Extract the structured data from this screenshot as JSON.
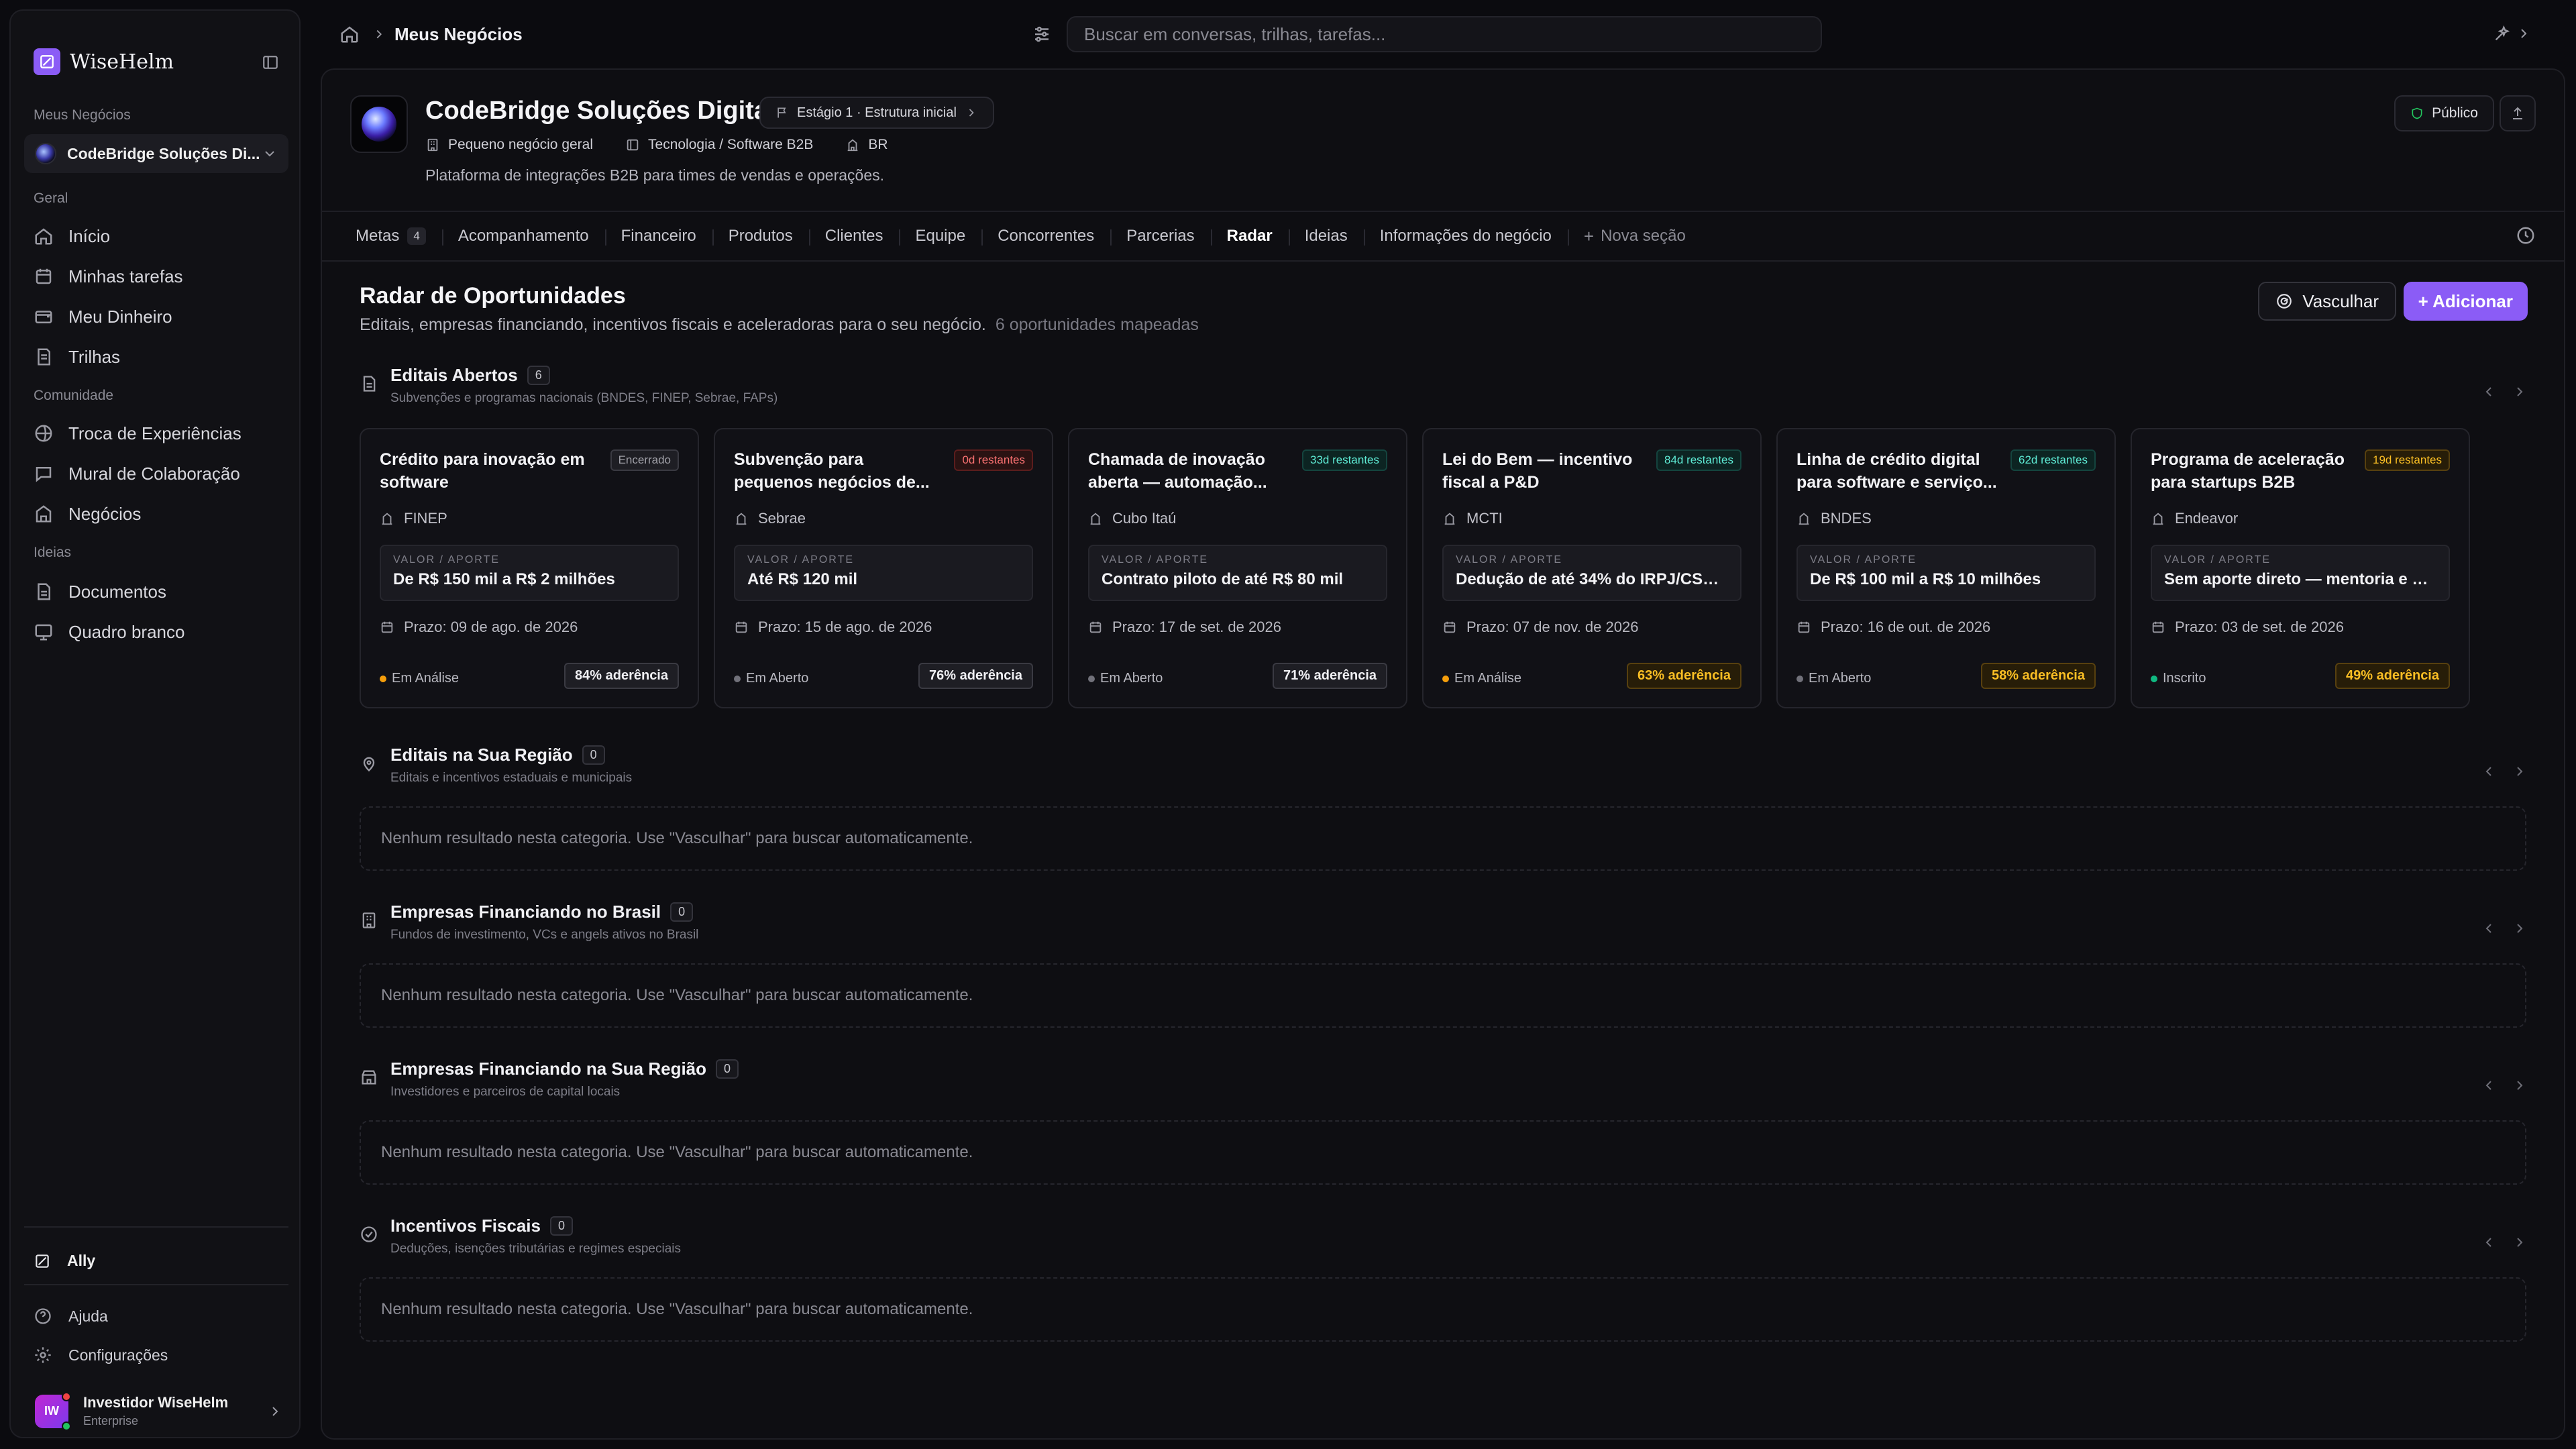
{
  "brand": {
    "name": "WiseHelm"
  },
  "sidebar": {
    "my_business_label": "Meus Negócios",
    "selected_business": "CodeBridge Soluções Di...",
    "general_label": "Geral",
    "general_items": [
      {
        "label": "Início",
        "icon": "home-icon"
      },
      {
        "label": "Minhas tarefas",
        "icon": "tasks-icon"
      },
      {
        "label": "Meu Dinheiro",
        "icon": "money-icon"
      },
      {
        "label": "Trilhas",
        "icon": "tracks-icon"
      }
    ],
    "community_label": "Comunidade",
    "community_items": [
      {
        "label": "Troca de Experiências",
        "icon": "chat-icon"
      },
      {
        "label": "Mural de Colaboração",
        "icon": "board-icon"
      },
      {
        "label": "Negócios",
        "icon": "business-icon"
      }
    ],
    "ideas_label": "Ideias",
    "ideas_items": [
      {
        "label": "Documentos",
        "icon": "document-icon"
      },
      {
        "label": "Quadro branco",
        "icon": "whiteboard-icon"
      }
    ],
    "ally": "Ally",
    "help": "Ajuda",
    "settings": "Configurações",
    "user": {
      "initials": "IW",
      "name": "Investidor WiseHelm",
      "plan": "Enterprise"
    }
  },
  "topbar": {
    "breadcrumb": "Meus Negócios",
    "search_placeholder": "Buscar em conversas, trilhas, tarefas..."
  },
  "business": {
    "name": "CodeBridge Soluções Digitais",
    "stage": "Estágio 1 · Estrutura inicial",
    "size": "Pequeno negócio geral",
    "sector": "Tecnologia / Software B2B",
    "country": "BR",
    "description": "Plataforma de integrações B2B para times de vendas e operações.",
    "visibility": "Público"
  },
  "tabs": [
    {
      "label": "Metas",
      "count": "4"
    },
    {
      "label": "Acompanhamento"
    },
    {
      "label": "Financeiro"
    },
    {
      "label": "Produtos"
    },
    {
      "label": "Clientes"
    },
    {
      "label": "Equipe"
    },
    {
      "label": "Concorrentes"
    },
    {
      "label": "Parcerias"
    },
    {
      "label": "Radar",
      "active": true
    },
    {
      "label": "Ideias"
    },
    {
      "label": "Informações do negócio"
    }
  ],
  "new_section": "Nova seção",
  "radar": {
    "title": "Radar de Oportunidades",
    "subtitle": "Editais, empresas financiando, incentivos fiscais e aceleradoras para o seu negócio.",
    "mapped": "6 oportunidades mapeadas",
    "scan_button": "Vasculhar",
    "add_button": "+ Adicionar"
  },
  "value_label": "VALOR / APORTE",
  "sections": [
    {
      "title": "Editais Abertos",
      "count": "6",
      "subtitle": "Subvenções e programas nacionais (BNDES, FINEP, Sebrae, FAPs)",
      "cards": [
        {
          "title": "Crédito para inovação em software",
          "badge": "Encerrado",
          "badge_tone": "closed",
          "org": "FINEP",
          "value": "De R$ 150 mil a R$ 2 milhões",
          "deadline": "Prazo: 09 de ago. de 2026",
          "status": "Em Análise",
          "status_color": "#f59e0b",
          "fit": "84% aderência",
          "fit_tone": "neutral"
        },
        {
          "title": "Subvenção para pequenos negócios de...",
          "badge": "0d restantes",
          "badge_tone": "red",
          "org": "Sebrae",
          "value": "Até R$ 120 mil",
          "deadline": "Prazo: 15 de ago. de 2026",
          "status": "Em Aberto",
          "status_color": "#71717a",
          "fit": "76% aderência",
          "fit_tone": "neutral"
        },
        {
          "title": "Chamada de inovação aberta — automação...",
          "badge": "33d restantes",
          "badge_tone": "green",
          "org": "Cubo Itaú",
          "value": "Contrato piloto de até R$ 80 mil",
          "deadline": "Prazo: 17 de set. de 2026",
          "status": "Em Aberto",
          "status_color": "#71717a",
          "fit": "71% aderência",
          "fit_tone": "neutral"
        },
        {
          "title": "Lei do Bem — incentivo fiscal a P&D",
          "badge": "84d restantes",
          "badge_tone": "green",
          "org": "MCTI",
          "value": "Dedução de até 34% do IRPJ/CSLL...",
          "deadline": "Prazo: 07 de nov. de 2026",
          "status": "Em Análise",
          "status_color": "#f59e0b",
          "fit": "63% aderência",
          "fit_tone": "amber"
        },
        {
          "title": "Linha de crédito digital para software e serviço...",
          "badge": "62d restantes",
          "badge_tone": "green",
          "org": "BNDES",
          "value": "De R$ 100 mil a R$ 10 milhões",
          "deadline": "Prazo: 16 de out. de 2026",
          "status": "Em Aberto",
          "status_color": "#71717a",
          "fit": "58% aderência",
          "fit_tone": "amber"
        },
        {
          "title": "Programa de aceleração para startups B2B",
          "badge": "19d restantes",
          "badge_tone": "amber",
          "org": "Endeavor",
          "value": "Sem aporte direto — mentoria e ac...",
          "deadline": "Prazo: 03 de set. de 2026",
          "status": "Inscrito",
          "status_color": "#10b981",
          "fit": "49% aderência",
          "fit_tone": "amber"
        }
      ]
    },
    {
      "title": "Editais na Sua Região",
      "count": "0",
      "subtitle": "Editais e incentivos estaduais e municipais"
    },
    {
      "title": "Empresas Financiando no Brasil",
      "count": "0",
      "subtitle": "Fundos de investimento, VCs e angels ativos no Brasil"
    },
    {
      "title": "Empresas Financiando na Sua Região",
      "count": "0",
      "subtitle": "Investidores e parceiros de capital locais"
    },
    {
      "title": "Incentivos Fiscais",
      "count": "0",
      "subtitle": "Deduções, isenções tributárias e regimes especiais"
    }
  ],
  "empty_message": "Nenhum resultado nesta categoria. Use \"Vasculhar\" para buscar automaticamente."
}
